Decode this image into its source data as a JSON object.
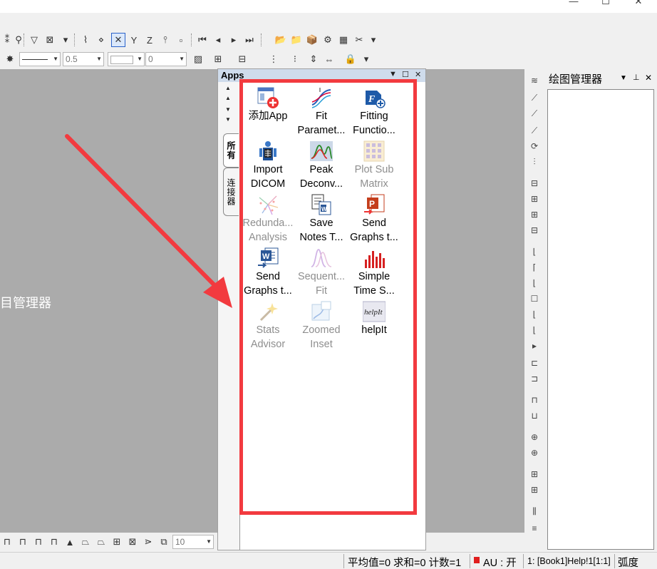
{
  "window": {
    "minimize_glyph": "—",
    "maximize_glyph": "☐",
    "close_glyph": "✕"
  },
  "toolbar2": {
    "line_width_value": "0.5",
    "number_value": "0"
  },
  "workspace": {
    "project_manager_label": "项目管理器"
  },
  "apps_panel": {
    "title": "Apps",
    "tabs": [
      "所有",
      "连接器"
    ],
    "apps": [
      {
        "label1": "添加App",
        "label2": "",
        "icon": "add-app-icon",
        "enabled": true
      },
      {
        "label1": "Fit",
        "label2": "Paramet...",
        "icon": "fit-parameters-icon",
        "enabled": true
      },
      {
        "label1": "Fitting",
        "label2": "Functio...",
        "icon": "fitting-functions-icon",
        "enabled": true
      },
      {
        "label1": "Import",
        "label2": "DICOM",
        "icon": "import-dicom-icon",
        "enabled": true
      },
      {
        "label1": "Peak",
        "label2": "Deconv...",
        "icon": "peak-deconvolution-icon",
        "enabled": true
      },
      {
        "label1": "Plot Sub",
        "label2": "Matrix",
        "icon": "plot-sub-matrix-icon",
        "enabled": false
      },
      {
        "label1": "Redunda...",
        "label2": "Analysis",
        "icon": "redundancy-analysis-icon",
        "enabled": false
      },
      {
        "label1": "Save",
        "label2": "Notes T...",
        "icon": "save-notes-icon",
        "enabled": true
      },
      {
        "label1": "Send",
        "label2": "Graphs t...",
        "icon": "send-graphs-ppt-icon",
        "enabled": true
      },
      {
        "label1": "Send",
        "label2": "Graphs t...",
        "icon": "send-graphs-word-icon",
        "enabled": true
      },
      {
        "label1": "Sequent...",
        "label2": "Fit",
        "icon": "sequential-fit-icon",
        "enabled": false
      },
      {
        "label1": "Simple",
        "label2": "Time S...",
        "icon": "simple-time-series-icon",
        "enabled": true
      },
      {
        "label1": "Stats",
        "label2": "Advisor",
        "icon": "stats-advisor-icon",
        "enabled": false
      },
      {
        "label1": "Zoomed",
        "label2": "Inset",
        "icon": "zoomed-inset-icon",
        "enabled": false
      },
      {
        "label1": "helpIt",
        "label2": "",
        "icon": "helpit-icon",
        "enabled": true
      }
    ]
  },
  "graph_manager": {
    "title": "绘图管理器"
  },
  "bottom_toolbar": {
    "zoom_value": "10"
  },
  "statusbar": {
    "stats": "平均值=0 求和=0 计数=1",
    "au": "AU : 开",
    "book_ref": "1: [Book1]Help!1[1:1]",
    "angle_unit": "弧度"
  },
  "colors": {
    "highlight": "#f23a3f",
    "panel_header": "#cfdcec",
    "workspace": "#ababab"
  }
}
